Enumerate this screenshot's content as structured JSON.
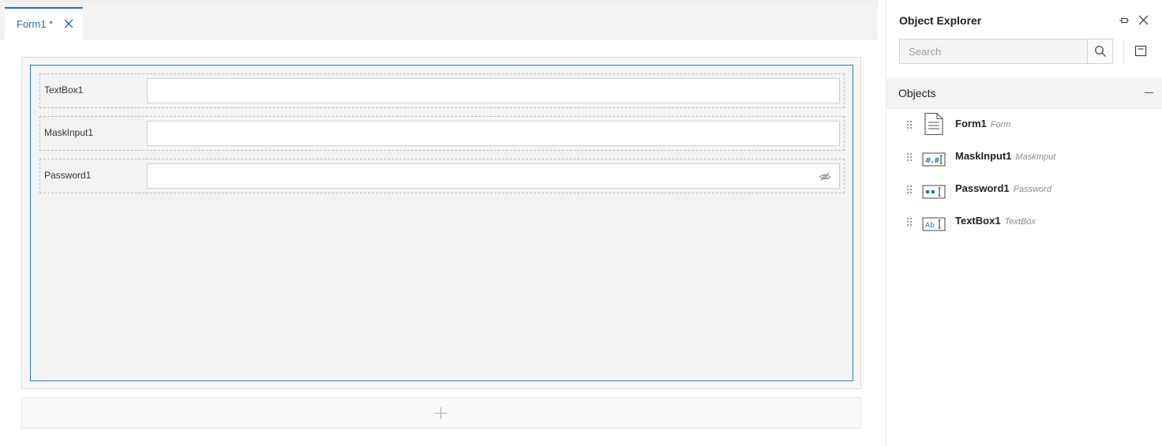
{
  "document": {
    "tab_label": "Form1 *",
    "fields": [
      {
        "label": "TextBox1"
      },
      {
        "label": "MaskInput1"
      },
      {
        "label": "Password1"
      }
    ]
  },
  "explorer": {
    "title": "Object Explorer",
    "search_placeholder": "Search",
    "section_title": "Objects",
    "items": [
      {
        "name": "Form1",
        "type": "Form",
        "icon": "form-icon"
      },
      {
        "name": "MaskInput1",
        "type": "MaskInput",
        "icon": "mask-input-icon"
      },
      {
        "name": "Password1",
        "type": "Password",
        "icon": "password-icon"
      },
      {
        "name": "TextBox1",
        "type": "TextBox",
        "icon": "textbox-icon"
      }
    ]
  },
  "colors": {
    "accent": "#1c6fb8",
    "form_border": "#2b7cc4",
    "canvas_bg": "#f3f3f3"
  }
}
